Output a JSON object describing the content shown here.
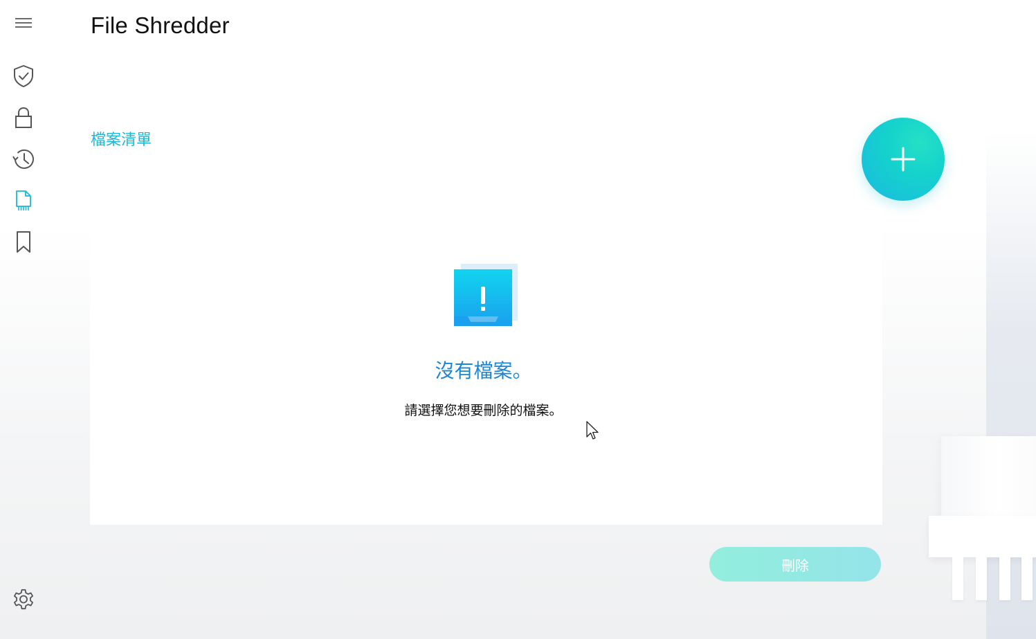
{
  "app": {
    "title": "File Shredder"
  },
  "sidebar": {
    "items": [
      {
        "name": "menu",
        "icon": "hamburger-icon"
      },
      {
        "name": "protection",
        "icon": "shield-check-icon"
      },
      {
        "name": "lock",
        "icon": "lock-icon"
      },
      {
        "name": "history",
        "icon": "history-icon"
      },
      {
        "name": "file-shredder",
        "icon": "shredded-file-icon",
        "active": true
      },
      {
        "name": "bookmark",
        "icon": "bookmark-icon"
      },
      {
        "name": "settings",
        "icon": "gear-icon"
      }
    ]
  },
  "file_list": {
    "label": "檔案清單",
    "empty_title": "沒有檔案。",
    "empty_subtitle": "請選擇您想要刪除的檔案。"
  },
  "actions": {
    "add_icon": "plus-icon",
    "delete_label": "刪除"
  },
  "colors": {
    "accent": "#1bb8d6",
    "empty_title": "#1a86d6",
    "add_button_start": "#25e0c6",
    "add_button_end": "#1ab9e3",
    "delete_button": "#8eeedb"
  }
}
